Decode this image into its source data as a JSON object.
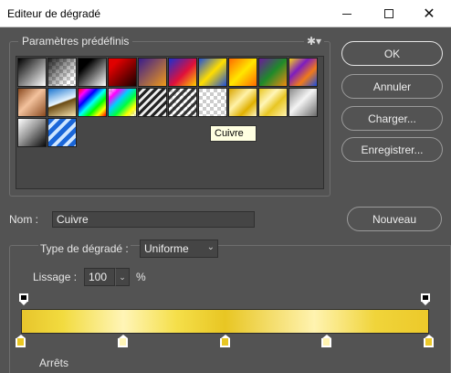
{
  "window": {
    "title": "Editeur de dégradé",
    "minimize_icon": "minimize-icon",
    "maximize_icon": "maximize-icon",
    "close_glyph": "✕"
  },
  "presets": {
    "label": "Paramètres prédéfinis",
    "gear_glyph": "✱▾",
    "tooltip": "Cuivre",
    "swatches": [
      {
        "name": "preset-black-white",
        "bg": "linear-gradient(135deg,#000 0%,#fff 100%)"
      },
      {
        "name": "preset-black-transparent",
        "bg": "linear-gradient(135deg,rgba(0,0,0,0.85) 0%,rgba(0,0,0,0) 80%), repeating-conic-gradient(#ffffff 0% 25%, #c8c8c8 0% 50%) 0 0/8px 8px"
      },
      {
        "name": "preset-black-to-white",
        "bg": "linear-gradient(135deg,#000 25%,#fff 100%)"
      },
      {
        "name": "preset-red-black",
        "bg": "linear-gradient(135deg,#e00000 20%,#1a0000 100%)"
      },
      {
        "name": "preset-violet-orange",
        "bg": "linear-gradient(135deg,#3a1d8c 0%,#f09a1a 100%)"
      },
      {
        "name": "preset-blue-red-yellow",
        "bg": "linear-gradient(135deg,#1a2fd0 0%,#e0103a 55%,#ffd000 100%)"
      },
      {
        "name": "preset-blue-yellow-blue",
        "bg": "linear-gradient(135deg,#1e4fd8 0%,#ffde00 50%,#1e4fd8 100%)"
      },
      {
        "name": "preset-orange-yellow-orange",
        "bg": "linear-gradient(135deg,#ff6a00 0%,#ffe600 50%,#ff6a00 100%)"
      },
      {
        "name": "preset-violet-green-orange",
        "bg": "linear-gradient(135deg,#6a1b9a 0%,#1f8a2a 50%,#f08a10 100%)"
      },
      {
        "name": "preset-yellow-violet-orange-blue",
        "bg": "linear-gradient(135deg,#f7d21a 0%,#7d1dbf 35%,#f07a1a 65%,#1c4fe0 100%)"
      },
      {
        "name": "preset-copper",
        "bg": "linear-gradient(135deg,#8a4a20 0%,#f3c29d 45%,#8a4a20 100%)"
      },
      {
        "name": "preset-chrome",
        "bg": "linear-gradient(160deg,#1b75d0 0%,#eaf6ff 48%,#6a4a12 52%,#f7e4b0 100%)"
      },
      {
        "name": "preset-spectrum",
        "bg": "linear-gradient(135deg,#ff0000,#ff00ff,#0000ff,#00ffff,#00ff00,#ffff00,#ff0000)"
      },
      {
        "name": "preset-transparent-rainbow",
        "bg": "linear-gradient(135deg,rgba(255,255,255,0) 0%,#ff00ff 20%,#00d0ff 40%,#00ff40 60%,#ffff00 80%,rgba(255,255,255,0) 100%), repeating-conic-gradient(#ffffff 0% 25%, #cfcfcf 0% 50%) 0 0/8px 8px"
      },
      {
        "name": "preset-transparent-stripes",
        "bg": "repeating-linear-gradient(135deg,#222 0px,#222 3px,#eeeeee 3px,#eeeeee 6px)"
      },
      {
        "name": "preset-stripes-transparent",
        "bg": "repeating-linear-gradient(135deg,rgba(0,0,0,0.75) 0px,rgba(0,0,0,0.75) 3px,rgba(255,255,255,0) 3px,rgba(255,255,255,0) 6px), repeating-conic-gradient(#ffffff 0% 25%, #cfcfcf 0% 50%) 0 0/8px 8px"
      },
      {
        "name": "preset-transparent",
        "bg": "repeating-conic-gradient(#ffffff 0% 25%, #cccccc 0% 50%) 0 0/8px 8px"
      },
      {
        "name": "preset-gold",
        "bg": "linear-gradient(135deg,#d9a400 0%,#fff2a8 40%,#e0b000 70%,#fff6c4 100%)"
      },
      {
        "name": "preset-cuivre-selected",
        "bg": "linear-gradient(135deg,#e8c623 0%,#fff5b7 35%,#e8c623 60%,#fff3b0 100%)"
      },
      {
        "name": "preset-steel",
        "bg": "linear-gradient(135deg,#8a8a8a 0%,#f4f4f4 45%,#6a6a6a 100%)"
      },
      {
        "name": "preset-silver-dark",
        "bg": "linear-gradient(135deg,#ffffff 0%,#9a9a9a 45%,#0a0a0a 100%)"
      },
      {
        "name": "preset-blue-white-stripes",
        "bg": "repeating-linear-gradient(135deg,#1a66d8 0px,#1a66d8 5px,#cfe6ff 5px,#cfe6ff 9px)"
      }
    ]
  },
  "buttons": {
    "ok": "OK",
    "cancel": "Annuler",
    "load": "Charger...",
    "save": "Enregistrer...",
    "new": "Nouveau"
  },
  "name_field": {
    "label": "Nom :",
    "value": "Cuivre"
  },
  "gradient_type": {
    "label": "Type de dégradé :",
    "value": "Uniforme",
    "chevron": "⌄"
  },
  "smoothness": {
    "label": "Lissage :",
    "value": "100",
    "unit": "%",
    "chevron": "⌄"
  },
  "stops": {
    "section_label": "Arrêts",
    "opacity_stop_positions": [
      0,
      100
    ],
    "color_stop_positions": [
      0,
      25,
      50,
      75,
      100
    ],
    "color_stop_colors": [
      "#e8c623",
      "#fff5b7",
      "#e8c623",
      "#fff3b0",
      "#ecc92a"
    ]
  },
  "colors": {
    "panel_bg": "#535353",
    "title_bg": "#ffffff",
    "tooltip_bg": "#ffffe1"
  }
}
